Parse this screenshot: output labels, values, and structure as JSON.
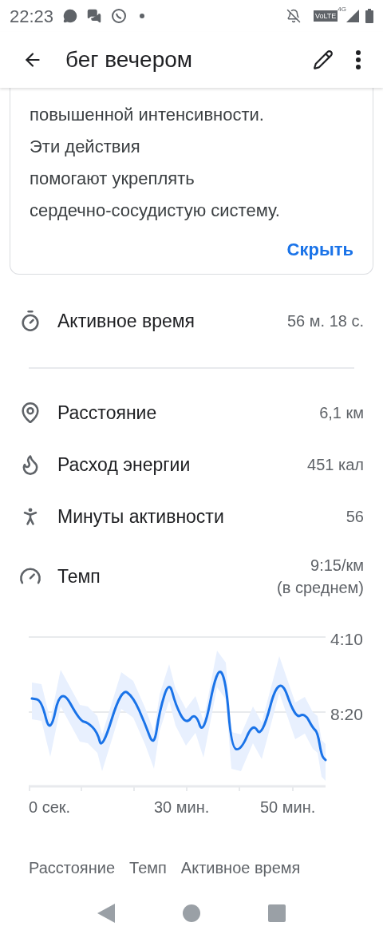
{
  "status_bar": {
    "time": "22:23",
    "network_badge": "VoLTE",
    "network_type": "4G"
  },
  "header": {
    "title": "бег вечером"
  },
  "info_card": {
    "lines": [
      "повышенной интенсивности.",
      "Эти действия",
      "помогают укреплять",
      "сердечно-сосудистую систему."
    ],
    "action": "Скрыть"
  },
  "summary": {
    "kind": "timer",
    "label": "Активное время",
    "value": "56 м. 18 с."
  },
  "metrics": [
    {
      "kind": "distance",
      "label": "Расстояние",
      "value": [
        "6,1 км"
      ]
    },
    {
      "kind": "energy",
      "label": "Расход энергии",
      "value": [
        "451 кал"
      ]
    },
    {
      "kind": "walk",
      "label": "Минуты активности",
      "value": [
        "56"
      ]
    },
    {
      "kind": "pace",
      "label": "Темп",
      "value": [
        "9:15/км",
        "(в среднем)"
      ]
    }
  ],
  "chart": {
    "y_tick_labels": [
      "4:10",
      "8:20"
    ],
    "x_tick_labels": [
      "0 сек.",
      "30 мин.",
      "50 мин."
    ]
  },
  "tabs": [
    {
      "label": "Расстояние"
    },
    {
      "label": "Темп"
    },
    {
      "label": "Активное время"
    }
  ]
}
